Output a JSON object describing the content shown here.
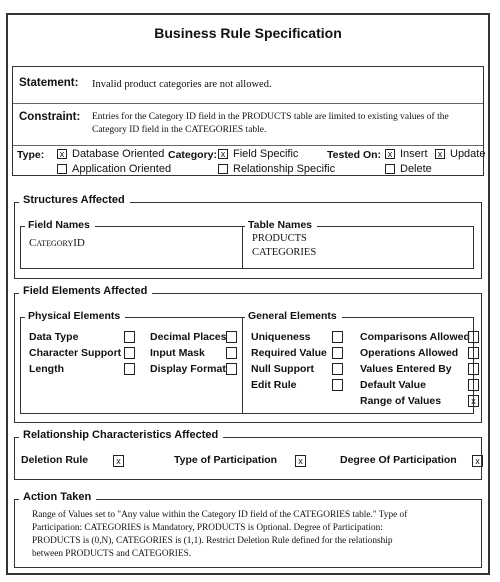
{
  "title": "Business Rule Specification",
  "statement": {
    "label": "Statement:",
    "text": "Invalid product categories are not allowed."
  },
  "constraint": {
    "label": "Constraint:",
    "line1": "Entries for the Category ID field in the PRODUCTS table are limited to existing values of the",
    "line2": "Category ID field in the CATEGORIES table."
  },
  "type": {
    "label": "Type:",
    "options": [
      {
        "label": "Database Oriented",
        "checked": true,
        "mark": "x"
      },
      {
        "label": "Application Oriented",
        "checked": false,
        "mark": ""
      }
    ]
  },
  "category": {
    "label": "Category:",
    "options": [
      {
        "label": "Field Specific",
        "checked": true,
        "mark": "x"
      },
      {
        "label": "Relationship Specific",
        "checked": false,
        "mark": ""
      }
    ]
  },
  "tested_on": {
    "label": "Tested On:",
    "options": [
      {
        "label": "Insert",
        "checked": true,
        "mark": "x"
      },
      {
        "label": "Update",
        "checked": true,
        "mark": "x"
      },
      {
        "label": "Delete",
        "checked": false,
        "mark": ""
      }
    ]
  },
  "structures": {
    "title": "Structures Affected",
    "field_names_title": "Field Names",
    "field_names": [
      "CategoryID"
    ],
    "table_names_title": "Table Names",
    "table_names": [
      "PRODUCTS",
      "CATEGORIES"
    ]
  },
  "field_elements": {
    "title": "Field Elements Affected",
    "physical": {
      "title": "Physical Elements",
      "col1": [
        {
          "label": "Data Type",
          "mark": ""
        },
        {
          "label": "Character Support",
          "mark": ""
        },
        {
          "label": "Length",
          "mark": ""
        }
      ],
      "col2": [
        {
          "label": "Decimal Places",
          "mark": ""
        },
        {
          "label": "Input Mask",
          "mark": ""
        },
        {
          "label": "Display Format",
          "mark": ""
        }
      ]
    },
    "general": {
      "title": "General Elements",
      "col1": [
        {
          "label": "Uniqueness",
          "mark": ""
        },
        {
          "label": "Required Value",
          "mark": ""
        },
        {
          "label": "Null Support",
          "mark": ""
        },
        {
          "label": "Edit Rule",
          "mark": ""
        }
      ],
      "col2": [
        {
          "label": "Comparisons Allowed",
          "mark": ""
        },
        {
          "label": "Operations Allowed",
          "mark": ""
        },
        {
          "label": "Values Entered By",
          "mark": ""
        },
        {
          "label": "Default Value",
          "mark": ""
        },
        {
          "label": "Range of Values",
          "mark": "x"
        }
      ]
    }
  },
  "relationship": {
    "title": "Relationship Characteristics Affected",
    "items": [
      {
        "label": "Deletion Rule",
        "mark": "x"
      },
      {
        "label": "Type of Participation",
        "mark": "x"
      },
      {
        "label": "Degree Of Participation",
        "mark": "x"
      }
    ]
  },
  "action": {
    "title": "Action Taken",
    "lines": [
      "Range of Values set to \"Any value within the Category ID field of the CATEGORIES table.\" Type of",
      "Participation: CATEGORIES is Mandatory, PRODUCTS is Optional. Degree of Participation:",
      "PRODUCTS is (0,N), CATEGORIES is (1,1). Restrict Deletion Rule defined for the relationship",
      "between PRODUCTS and CATEGORIES."
    ]
  }
}
